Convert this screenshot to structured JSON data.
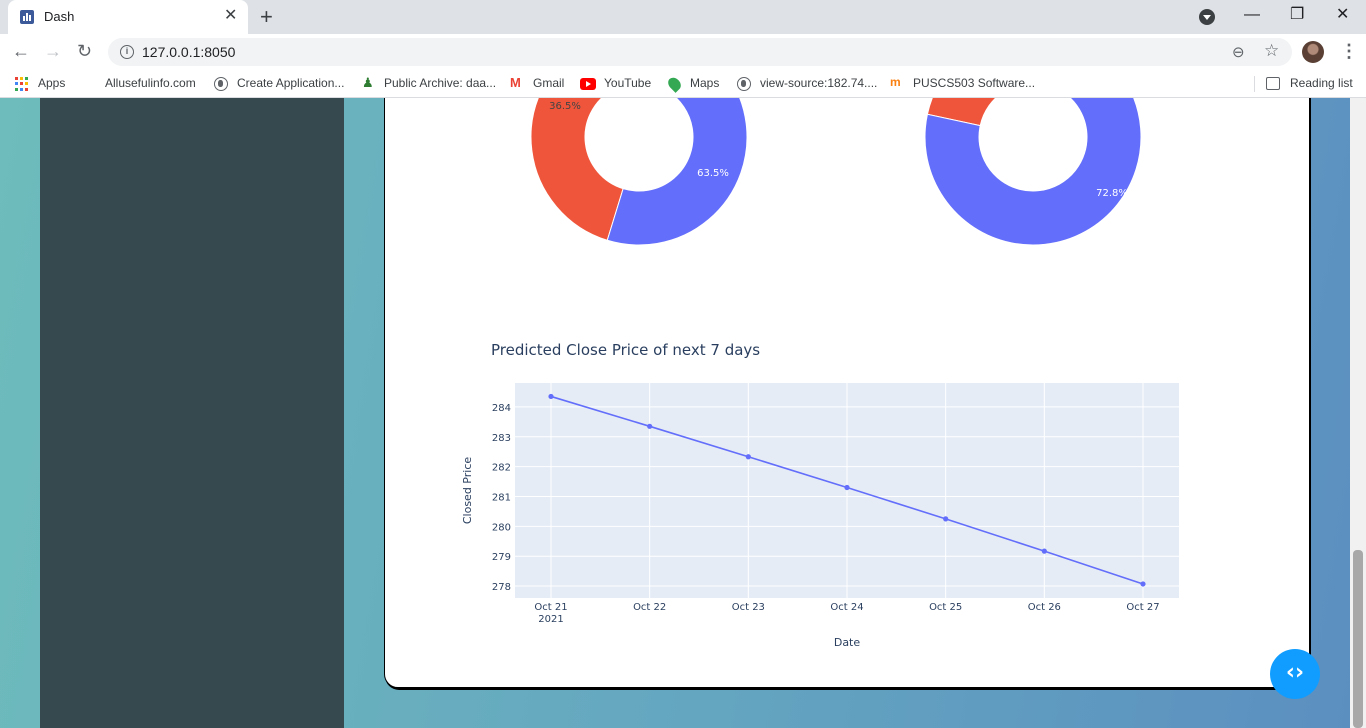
{
  "browser": {
    "tab_title": "Dash",
    "tab_close": "✕",
    "new_tab": "+",
    "url": "127.0.0.1:8050",
    "window_controls": {
      "minimize": "—",
      "restore": "❐",
      "close": "✕"
    },
    "reading_list": "Reading list",
    "bookmarks": [
      {
        "label": "Apps",
        "icon": "apps-grid-icon"
      },
      {
        "label": "Allusefulinfo.com",
        "icon": "none"
      },
      {
        "label": "Create Application...",
        "icon": "globe-icon"
      },
      {
        "label": "Public Archive: daa...",
        "icon": "pin-icon"
      },
      {
        "label": "Gmail",
        "icon": "gmail-icon"
      },
      {
        "label": "YouTube",
        "icon": "youtube-icon"
      },
      {
        "label": "Maps",
        "icon": "maps-icon"
      },
      {
        "label": "view-source:182.74....",
        "icon": "globe-icon"
      },
      {
        "label": "PUSCS503 Software...",
        "icon": "moodle-icon"
      }
    ]
  },
  "colors": {
    "blue": "#636efa",
    "red": "#ef553b",
    "plot_bg": "#e5ecf6",
    "sidebar": "#36494e",
    "fab": "#119dff"
  },
  "charts": {
    "donut_left": {
      "labels": [
        "36.5%",
        "63.5%"
      ],
      "values": [
        36.5,
        63.5
      ]
    },
    "donut_right": {
      "labels": [
        "72.8%"
      ],
      "values": [
        27.2,
        72.8
      ]
    }
  },
  "chart_data": {
    "type": "line",
    "title": "Predicted Close Price of next 7 days",
    "xlabel": "Date",
    "ylabel": "Closed Price",
    "x": [
      "Oct 21",
      "Oct 22",
      "Oct 23",
      "Oct 24",
      "Oct 25",
      "Oct 26",
      "Oct 27"
    ],
    "x_sub": "2021",
    "y": [
      284.35,
      283.35,
      282.33,
      281.3,
      280.25,
      279.17,
      278.07
    ],
    "yticks": [
      278,
      279,
      280,
      281,
      282,
      283,
      284
    ],
    "ylim": [
      277.6,
      284.8
    ],
    "grid": true
  },
  "fab_label": "‹›"
}
